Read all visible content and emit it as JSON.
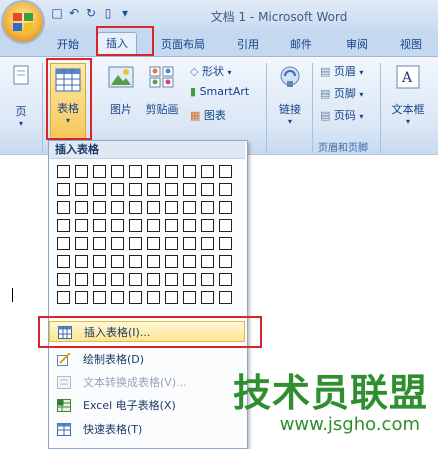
{
  "window": {
    "title": "文档 1 - Microsoft Word"
  },
  "tabs": [
    "开始",
    "插入",
    "页面布局",
    "引用",
    "邮件",
    "审阅",
    "视图"
  ],
  "ribbon": {
    "page_label": "页",
    "table_label": "表格",
    "picture_label": "图片",
    "clipart_label": "剪贴画",
    "shapes_label": "形状",
    "smartart_label": "SmartArt",
    "chart_label": "图表",
    "link_label": "链接",
    "header_label": "页眉",
    "footer_label": "页脚",
    "pagenum_label": "页码",
    "header_footer_group": "页眉和页脚",
    "textbox_label": "文本框"
  },
  "menu": {
    "header": "插入表格",
    "grid": {
      "columns": 10,
      "rows": 8
    },
    "items": [
      {
        "label": "插入表格(I)...",
        "icon": "insert-table-icon",
        "highlighted": true,
        "enabled": true
      },
      {
        "label": "绘制表格(D)",
        "icon": "draw-table-icon",
        "highlighted": false,
        "enabled": true
      },
      {
        "label": "文本转换成表格(V)...",
        "icon": "text-to-table-icon",
        "highlighted": false,
        "enabled": false
      },
      {
        "label": "Excel 电子表格(X)",
        "icon": "excel-icon",
        "highlighted": false,
        "enabled": true
      },
      {
        "label": "快速表格(T)",
        "icon": "quick-table-icon",
        "highlighted": false,
        "enabled": true
      }
    ]
  },
  "watermark": {
    "main": "技术员联盟",
    "url": "www.jsgho.com"
  },
  "colors": {
    "highlight_box": "#d8242b",
    "menu_highlight": "#fde48e",
    "watermark": "#2f8f2f"
  }
}
